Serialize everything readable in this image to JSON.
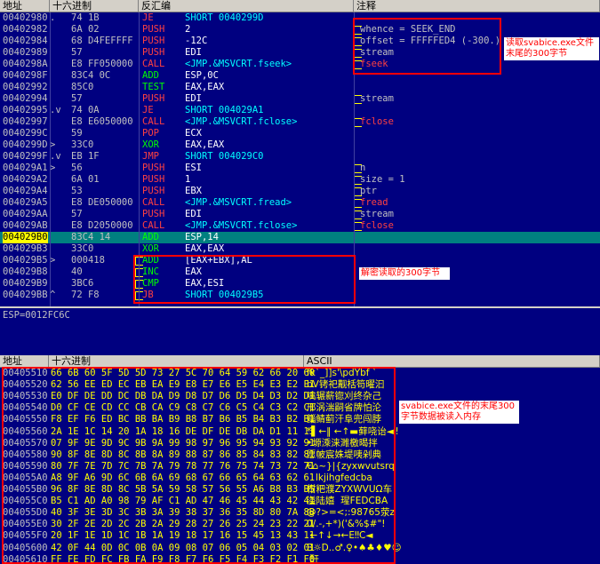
{
  "disasm_header": {
    "addr": "地址",
    "hex": "十六进制",
    "disasm": "反汇编",
    "comment": "注释"
  },
  "disasm_rows": [
    {
      "addr": "00402980",
      "g": ".",
      "hex": "74 1B",
      "mn": "JE",
      "op": "SHORT 0040299D",
      "cm": ""
    },
    {
      "addr": "00402982",
      "g": "",
      "hex": "6A 02",
      "mn": "PUSH",
      "op": "2",
      "cm": "whence = SEEK_END"
    },
    {
      "addr": "00402984",
      "g": "",
      "hex": "68 D4FEFFFF",
      "mn": "PUSH",
      "op": "-12C",
      "cm": "offset = FFFFFED4 (-300.)"
    },
    {
      "addr": "00402989",
      "g": "",
      "hex": "57",
      "mn": "PUSH",
      "op": "EDI",
      "cm": "stream"
    },
    {
      "addr": "0040298A",
      "g": "",
      "hex": "E8 FF050000",
      "mn": "CALL",
      "op": "<JMP.&MSVCRT.fseek>",
      "cm": "fseek"
    },
    {
      "addr": "0040298F",
      "g": "",
      "hex": "83C4 0C",
      "mn": "ADD",
      "op": "ESP,0C",
      "cm": ""
    },
    {
      "addr": "00402992",
      "g": "",
      "hex": "85C0",
      "mn": "TEST",
      "op": "EAX,EAX",
      "cm": ""
    },
    {
      "addr": "00402994",
      "g": "",
      "hex": "57",
      "mn": "PUSH",
      "op": "EDI",
      "cm": "stream"
    },
    {
      "addr": "00402995",
      "g": ".v",
      "hex": "74 0A",
      "mn": "JE",
      "op": "SHORT 004029A1",
      "cm": ""
    },
    {
      "addr": "00402997",
      "g": "",
      "hex": "E8 E6050000",
      "mn": "CALL",
      "op": "<JMP.&MSVCRT.fclose>",
      "cm": "fclose"
    },
    {
      "addr": "0040299C",
      "g": "",
      "hex": "59",
      "mn": "POP",
      "op": "ECX",
      "cm": ""
    },
    {
      "addr": "0040299D",
      "g": ">",
      "hex": "33C0",
      "mn": "XOR",
      "op": "EAX,EAX",
      "cm": ""
    },
    {
      "addr": "0040299F",
      "g": ".v",
      "hex": "EB 1F",
      "mn": "JMP",
      "op": "SHORT 004029C0",
      "cm": ""
    },
    {
      "addr": "004029A1",
      "g": ">",
      "hex": "56",
      "mn": "PUSH",
      "op": "ESI",
      "cm": "n"
    },
    {
      "addr": "004029A2",
      "g": "",
      "hex": "6A 01",
      "mn": "PUSH",
      "op": "1",
      "cm": "size = 1"
    },
    {
      "addr": "004029A4",
      "g": "",
      "hex": "53",
      "mn": "PUSH",
      "op": "EBX",
      "cm": "ptr"
    },
    {
      "addr": "004029A5",
      "g": "",
      "hex": "E8 DE050000",
      "mn": "CALL",
      "op": "<JMP.&MSVCRT.fread>",
      "cm": "fread"
    },
    {
      "addr": "004029AA",
      "g": "",
      "hex": "57",
      "mn": "PUSH",
      "op": "EDI",
      "cm": "stream"
    },
    {
      "addr": "004029AB",
      "g": "",
      "hex": "E8 D2050000",
      "mn": "CALL",
      "op": "<JMP.&MSVCRT.fclose>",
      "cm": "fclose"
    },
    {
      "addr": "004029B0",
      "g": "",
      "hex": "83C4 14",
      "mn": "ADD",
      "op": "ESP,14",
      "cm": ""
    },
    {
      "addr": "004029B3",
      "g": "",
      "hex": "33C0",
      "mn": "XOR",
      "op": "EAX,EAX",
      "cm": ""
    },
    {
      "addr": "004029B5",
      "g": ">",
      "hex": "000418",
      "mn": "ADD",
      "op": "[EAX+EBX],AL",
      "cm": ""
    },
    {
      "addr": "004029B8",
      "g": "",
      "hex": "40",
      "mn": "INC",
      "op": "EAX",
      "cm": ""
    },
    {
      "addr": "004029B9",
      "g": "",
      "hex": "3BC6",
      "mn": "CMP",
      "op": "EAX,ESI",
      "cm": ""
    },
    {
      "addr": "004029BB",
      "g": "^",
      "hex": "72 F8",
      "mn": "JB",
      "op": "SHORT 004029B5",
      "cm": ""
    }
  ],
  "info_text": "ESP=0012FC6C",
  "dump_header": {
    "addr": "地址",
    "hex": "十六进制",
    "ascii": "ASCII"
  },
  "dump_rows": [
    {
      "addr": "00405510",
      "bytes": "66 6B 60 5F 5D 5D 73 27 5C 70 64 59 62 66 20 60",
      "ascii": "fk`_]]s'\\pdYbf `"
    },
    {
      "addr": "00405520",
      "bytes": "62 56 EE ED EC EB EA E9 E8 E7 E6 E5 E4 E3 E2 E1",
      "ascii": "bV铐祀觏栝笱曜汩"
    },
    {
      "addr": "00405530",
      "bytes": "E0 DF DE DD DC DB DA D9 D8 D7 D6 D5 D4 D3 D2 D1",
      "ascii": "噙辗薪锪刈终杂己"
    },
    {
      "addr": "00405540",
      "bytes": "D0 CF CE CD CC CB CA C9 C8 C7 C6 C5 C4 C3 C2 C1",
      "ascii": "邢涡湍嗣省牌怕沦"
    },
    {
      "addr": "00405550",
      "bytes": "F8 EF F6 ED BC BB BA B9 B8 B7 B6 B5 B4 B3 B2 B1",
      "ascii": "鲻鲭蓟汗阜兜闯脖"
    },
    {
      "addr": "00405560",
      "bytes": "2A 1E 1C 14 20 1A 18 16 DE DF DE DB DA D1 11 13",
      "ascii": "*▌←‖ ←↑▬藓哓诒◄‼"
    },
    {
      "addr": "00405570",
      "bytes": "07 9F 9E 9D 9C 9B 9A 99 98 97 96 95 94 93 92 91",
      "ascii": "•塬溗涞濉檄暍拌"
    },
    {
      "addr": "00405580",
      "bytes": "90 8F 8E 8D 8C 8B 8A 89 88 87 86 85 84 83 82 81",
      "ascii": "愿帔宸姝堤咦剁典"
    },
    {
      "addr": "00405590",
      "bytes": "80 7F 7E 7D 7C 7B 7A 79 78 77 76 75 74 73 72 71",
      "ascii": "€⌂~}|{zyxwvutsrq"
    },
    {
      "addr": "004055A0",
      "bytes": "A8 9F A6 9D 6C 6B 6A 69 68 67 66 65 64 63 62 61",
      "ascii": "   lkjihgfedcba"
    },
    {
      "addr": "004055B0",
      "bytes": "96 8F 8E 8D 8C 5B 5A 59 58 57 56 55 A6 B8 B3 B5",
      "ascii": "柑粑濮ZYXWVUΩ车"
    },
    {
      "addr": "004055C0",
      "bytes": "B5 C1 AD A0 98 79 AF C1 AD 47 46 45 44 43 42 41",
      "ascii": "溢陆嬉  瑆FEDCBA"
    },
    {
      "addr": "004055D0",
      "bytes": "40 3F 3E 3D 3C 3B 3A 39 38 37 36 35 8D 80 7A 8B",
      "ascii": "@?>=<;:98765荥z"
    },
    {
      "addr": "004055E0",
      "bytes": "30 2F 2E 2D 2C 2B 2A 29 28 27 26 25 24 23 22 21",
      "ascii": "0/.-,+*)('&%$#\"!"
    },
    {
      "addr": "004055F0",
      "bytes": "20 1F 1E 1D 1C 1B 1A 19 18 17 16 15 45 13 43 11",
      "ascii": " ←↑↓→←E‼C◄"
    },
    {
      "addr": "00405600",
      "bytes": "42 0F 44 0D 0C 0B 0A 09 08 07 06 05 04 03 02 01",
      "ascii": "B☼D..♂.♀•♠♣♦♥☺"
    },
    {
      "addr": "00405610",
      "bytes": "FF FE FD FC FB FA F9 F8 F7 F6 F5 F4 F3 F2 F1 F0",
      "ascii": " 酐"
    }
  ],
  "annotations": {
    "read": "读取svabice.exe文件末尾的300字节",
    "decrypt": "解密读取的300字节",
    "dump": "svabice.exe文件的末尾300字节数据被读入内存"
  },
  "colors": {
    "mnemonic_red": "#ff4040",
    "mnemonic_green": "#00ff00",
    "mnemonic_cyan": "#00ffff",
    "operand_red": "#ff6060",
    "comment_red": "#ff4040",
    "selected_bg": "#008080"
  }
}
